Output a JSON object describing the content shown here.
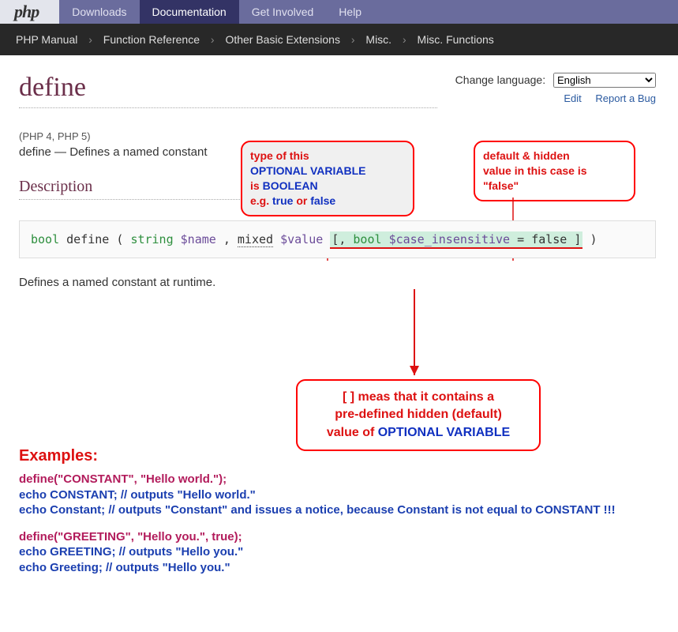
{
  "nav": {
    "logo": "php",
    "items": [
      "Downloads",
      "Documentation",
      "Get Involved",
      "Help"
    ],
    "active": 1
  },
  "breadcrumb": [
    "PHP Manual",
    "Function Reference",
    "Other Basic Extensions",
    "Misc.",
    "Misc. Functions"
  ],
  "lang": {
    "label": "Change language:",
    "selected": "English",
    "edit": "Edit",
    "report": "Report a Bug"
  },
  "title": "define",
  "versions": "(PHP 4, PHP 5)",
  "short_name": "define",
  "short_dash": " — ",
  "short_desc": "Defines a named constant",
  "section_desc": "Description",
  "sig": {
    "ret": "bool",
    "fn": "define",
    "p1t": "string",
    "p1": "$name",
    "p2t": "mixed",
    "p2": "$value",
    "optL": "[",
    "optLc": ", ",
    "optT": "bool",
    "optP": "$case_insensitive",
    "optEq": " = ",
    "optDef": "false",
    "optR": " ]"
  },
  "runtime": "Defines a named constant at runtime.",
  "callouts": {
    "c1_l1": "type of this",
    "c1_l2": "OPTIONAL VARIABLE",
    "c1_l3a": "is ",
    "c1_l3b": "BOOLEAN",
    "c1_l4a": "e.g. ",
    "c1_l4b": "true",
    "c1_l4c": " or ",
    "c1_l4d": "false",
    "c2_l1": "default & hidden",
    "c2_l2": "value in this case is",
    "c2_l3": "\"false\"",
    "c3_l1a": "[ ]",
    "c3_l1b": " meas that it contains a",
    "c3_l2": "pre-defined hidden (default)",
    "c3_l3a": "value of  ",
    "c3_l3b": "OPTIONAL VARIABLE"
  },
  "examples": {
    "title": "Examples:",
    "b1": [
      {
        "t": "define(\"CONSTANT\", \"Hello world.\");",
        "c": "crimson"
      },
      {
        "t": "echo CONSTANT; // outputs \"Hello world.\"",
        "c": "blue"
      },
      {
        "t": "echo Constant; // outputs \"Constant\" and issues a notice, because Constant is not equal to CONSTANT !!!",
        "c": "blue"
      }
    ],
    "b2": [
      {
        "t": "define(\"GREETING\", \"Hello you.\", true);",
        "c": "crimson"
      },
      {
        "t": "echo GREETING; // outputs \"Hello you.\"",
        "c": "blue"
      },
      {
        "t": "echo Greeting; // outputs \"Hello you.\"",
        "c": "blue"
      }
    ]
  }
}
